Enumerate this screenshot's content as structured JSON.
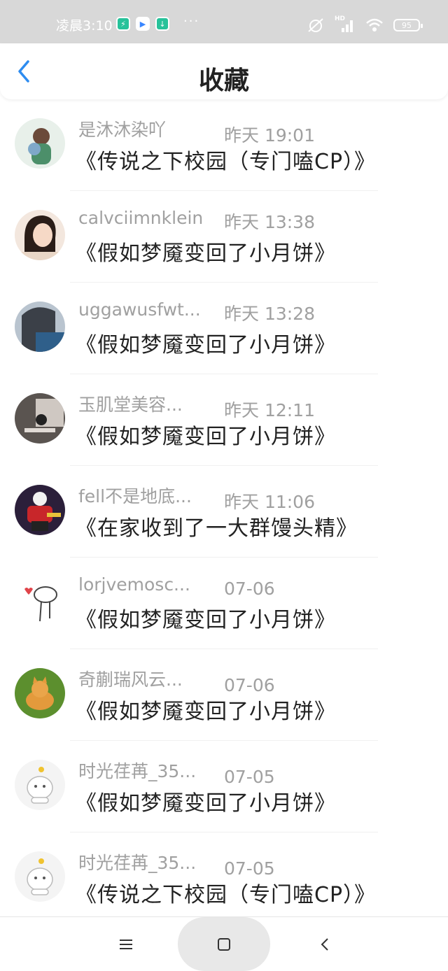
{
  "status": {
    "time": "凌晨3:10",
    "dots": "···",
    "battery": "95",
    "hd": "HD"
  },
  "header": {
    "title": "收藏"
  },
  "items": [
    {
      "name": "是沐沐染吖",
      "time": "昨天 19:01",
      "story": "《传说之下校园（专门嗑CP）》"
    },
    {
      "name": "calvciimnklein",
      "time": "昨天 13:38",
      "story": "《假如梦魇变回了小月饼》"
    },
    {
      "name": "uggawusfwt...",
      "time": "昨天 13:28",
      "story": "《假如梦魇变回了小月饼》"
    },
    {
      "name": "玉肌堂美容...",
      "time": "昨天 12:11",
      "story": "《假如梦魇变回了小月饼》"
    },
    {
      "name": "fell不是地底...",
      "time": "昨天 11:06",
      "story": "《在家收到了一大群馒头精》"
    },
    {
      "name": "lorjvemosc...",
      "time": "07-06",
      "story": "《假如梦魇变回了小月饼》"
    },
    {
      "name": "奇蒯瑞风云...",
      "time": "07-06",
      "story": "《假如梦魇变回了小月饼》"
    },
    {
      "name": "时光荏苒_35...",
      "time": "07-05",
      "story": "《假如梦魇变回了小月饼》"
    },
    {
      "name": "时光荏苒_35...",
      "time": "07-05",
      "story": "《传说之下校园（专门嗑CP）》"
    }
  ],
  "colors": {
    "accent": "#2d8cf0",
    "statusbar": "#d8d8d8",
    "meta_text": "#a0a0a0",
    "body_text": "#222222"
  }
}
